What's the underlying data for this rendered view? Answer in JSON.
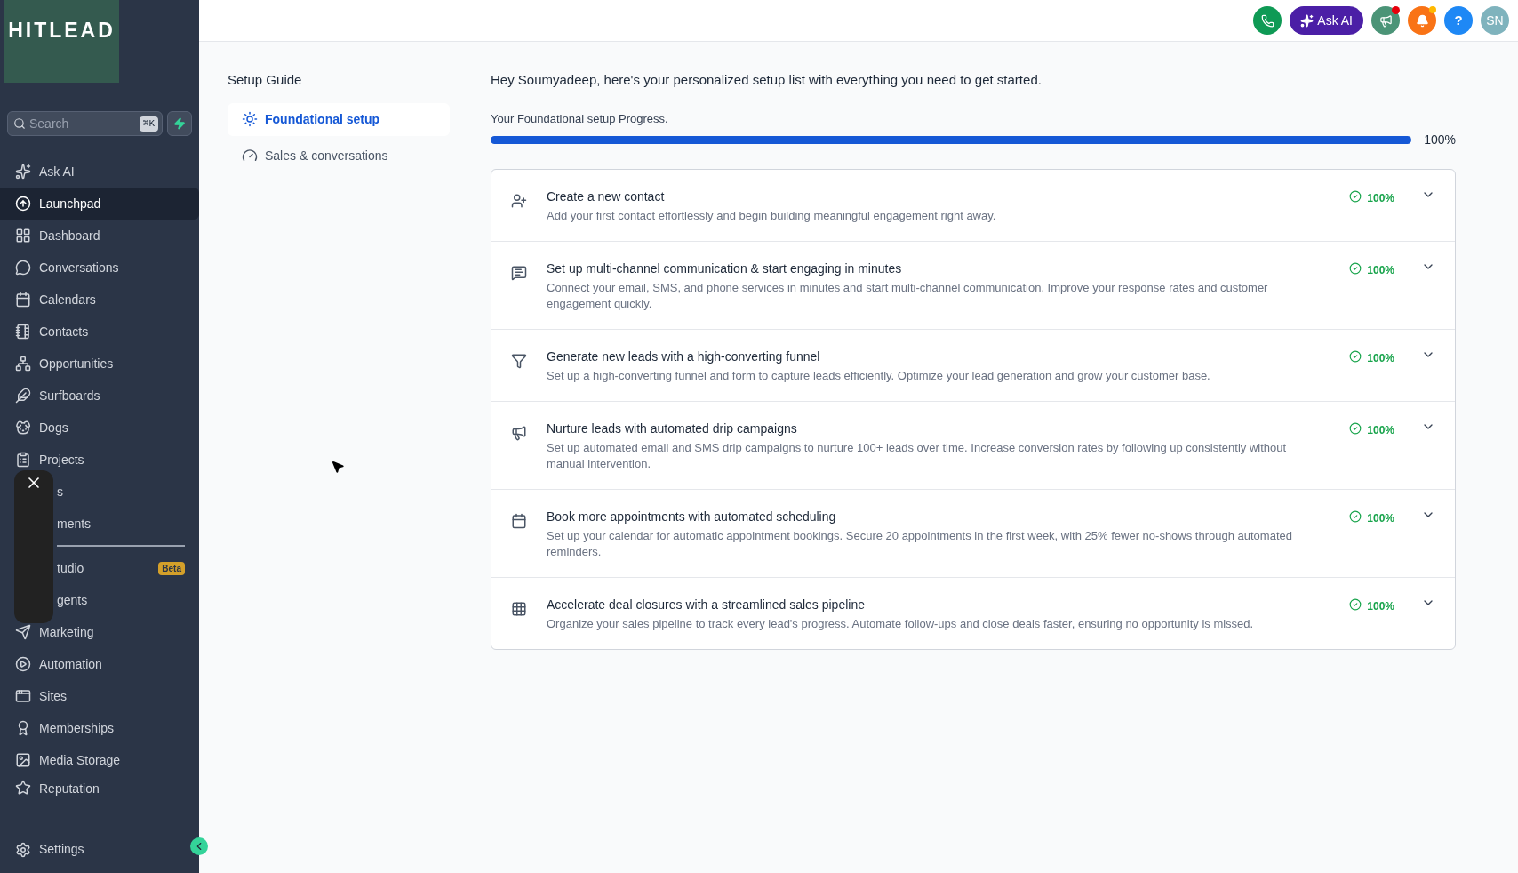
{
  "sidebar": {
    "logo": "HITLEAD",
    "search": {
      "placeholder": "Search",
      "shortcut": "⌘K"
    },
    "items": [
      {
        "label": "Ask AI",
        "selected": false,
        "covered": false
      },
      {
        "label": "Launchpad",
        "selected": true,
        "covered": false
      },
      {
        "label": "Dashboard",
        "selected": false,
        "covered": false
      },
      {
        "label": "Conversations",
        "selected": false,
        "covered": false
      },
      {
        "label": "Calendars",
        "selected": false,
        "covered": false
      },
      {
        "label": "Contacts",
        "selected": false,
        "covered": false
      },
      {
        "label": "Opportunities",
        "selected": false,
        "covered": false
      },
      {
        "label": "Surfboards",
        "selected": false,
        "covered": false
      },
      {
        "label": "Dogs",
        "selected": false,
        "covered": false
      },
      {
        "label": "Projects",
        "selected": false,
        "covered": false
      },
      {
        "label": "s",
        "selected": false,
        "covered": true
      },
      {
        "label": "ments",
        "selected": false,
        "covered": true
      },
      {
        "label": "tudio",
        "selected": false,
        "covered": true,
        "badge": "Beta"
      },
      {
        "label": "gents",
        "selected": false,
        "covered": true
      },
      {
        "label": "Marketing",
        "selected": false,
        "covered": false
      },
      {
        "label": "Automation",
        "selected": false,
        "covered": false
      },
      {
        "label": "Sites",
        "selected": false,
        "covered": false
      },
      {
        "label": "Memberships",
        "selected": false,
        "covered": false
      },
      {
        "label": "Media Storage",
        "selected": false,
        "covered": false
      },
      {
        "label": "Reputation",
        "selected": false,
        "covered": false
      }
    ],
    "settings": "Settings"
  },
  "topbar": {
    "ask_ai": "Ask AI",
    "help": "?",
    "avatar": "SN"
  },
  "guide": {
    "title": "Setup Guide",
    "tabs": [
      {
        "label": "Foundational setup",
        "selected": true
      },
      {
        "label": "Sales & conversations",
        "selected": false
      }
    ]
  },
  "main": {
    "greeting": "Hey Soumyadeep, here's your personalized setup list with everything you need to get started.",
    "progress": {
      "label": "Your Foundational setup Progress.",
      "level": 1,
      "reading": "100%"
    },
    "tasks": [
      {
        "title": "Create a new contact",
        "description": "Add your first contact effortlessly and begin building meaningful engagement right away.",
        "status": "100%",
        "complete": true
      },
      {
        "title": "Set up multi-channel communication & start engaging in minutes",
        "description": "Connect your email, SMS, and phone services in minutes and start multi-channel communication. Improve your response rates and customer engagement quickly.",
        "status": "100%",
        "complete": true
      },
      {
        "title": "Generate new leads with a high-converting funnel",
        "description": "Set up a high-converting funnel and form to capture leads efficiently. Optimize your lead generation and grow your customer base.",
        "status": "100%",
        "complete": true
      },
      {
        "title": "Nurture leads with automated drip campaigns",
        "description": "Set up automated email and SMS drip campaigns to nurture 100+ leads over time. Increase conversion rates by following up consistently without manual intervention.",
        "status": "100%",
        "complete": true
      },
      {
        "title": "Book more appointments with automated scheduling",
        "description": "Set up your calendar for automatic appointment bookings. Secure 20 appointments in the first week, with 25% fewer no-shows through automated reminders.",
        "status": "100%",
        "complete": true
      },
      {
        "title": "Accelerate deal closures with a streamlined sales pipeline",
        "description": "Organize your sales pipeline to track every lead's progress. Automate follow-ups and close deals faster, ensuring no opportunity is missed.",
        "status": "100%",
        "complete": true
      }
    ]
  }
}
